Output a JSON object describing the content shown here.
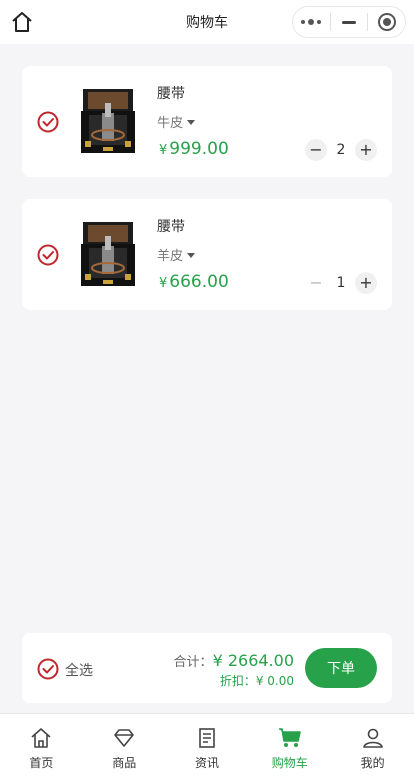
{
  "header": {
    "title": "购物车",
    "home_icon": "home-icon",
    "capsule": [
      "more-icon",
      "minimize-icon",
      "target-icon"
    ]
  },
  "cart": {
    "items": [
      {
        "name": "腰带",
        "spec": "牛皮",
        "currency": "¥",
        "price": "999.00",
        "quantity": "2",
        "selected": true
      },
      {
        "name": "腰带",
        "spec": "羊皮",
        "currency": "¥",
        "price": "666.00",
        "quantity": "1",
        "selected": true
      }
    ],
    "decrement_label": "−",
    "increment_label": "+"
  },
  "summary": {
    "select_all_label": "全选",
    "total_label": "合计：",
    "total_value": "¥ 2664.00",
    "discount_label": "折扣：",
    "discount_value": "¥ 0.00",
    "order_button_label": "下单"
  },
  "tabbar": {
    "items": [
      {
        "label": "首页",
        "icon": "home-icon",
        "active": false
      },
      {
        "label": "商品",
        "icon": "diamond-icon",
        "active": false
      },
      {
        "label": "资讯",
        "icon": "document-icon",
        "active": false
      },
      {
        "label": "购物车",
        "icon": "cart-icon",
        "active": true
      },
      {
        "label": "我的",
        "icon": "user-icon",
        "active": false
      }
    ]
  },
  "colors": {
    "accent": "#27a24a",
    "check": "#c0272d",
    "background": "#f5f5f7"
  }
}
